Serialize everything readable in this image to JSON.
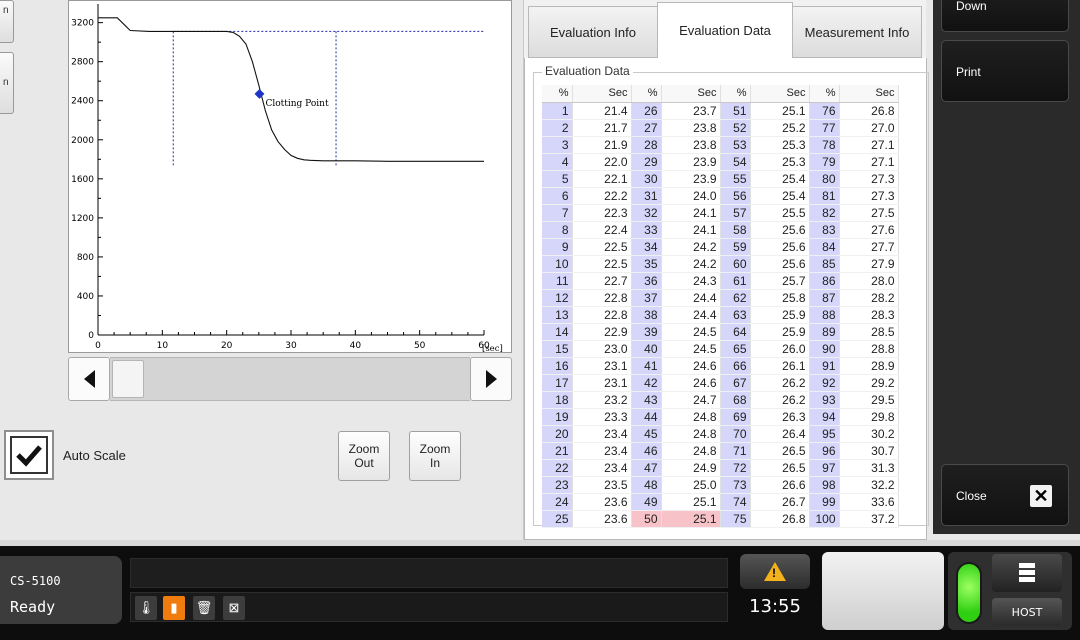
{
  "left_stubs": [
    "n",
    "n"
  ],
  "chart_data": {
    "type": "line",
    "x": [
      0,
      3,
      5,
      8,
      10,
      12,
      15,
      18,
      20,
      21,
      22,
      23,
      24,
      25,
      26,
      27,
      28,
      29,
      30,
      31,
      32,
      33,
      35,
      38,
      40,
      45,
      50,
      55,
      60
    ],
    "y": [
      3250,
      3250,
      3120,
      3110,
      3110,
      3110,
      3110,
      3110,
      3110,
      3100,
      3060,
      2980,
      2800,
      2560,
      2300,
      2100,
      1980,
      1900,
      1840,
      1810,
      1795,
      1790,
      1785,
      1785,
      1785,
      1780,
      1780,
      1780,
      1780
    ],
    "xlim": [
      0,
      60
    ],
    "ylim": [
      0,
      3350
    ],
    "x_ticks": [
      0,
      10,
      20,
      30,
      40,
      50,
      60
    ],
    "y_ticks": [
      0,
      400,
      800,
      1200,
      1600,
      2000,
      2400,
      2800,
      3200
    ],
    "x_unit": "[sec]",
    "clotting_point": {
      "x": 25.1,
      "y": 2470,
      "label": "Clotting Point"
    },
    "reference_line_y": 3110,
    "vertical_markers_x": [
      11.7,
      37.0
    ],
    "marker_bottom_y": 1780
  },
  "controls": {
    "auto_scale_label": "Auto Scale",
    "auto_scale_checked": true,
    "zoom_out_label": "Zoom\nOut",
    "zoom_in_label": "Zoom\nIn"
  },
  "tabs": [
    {
      "label": "Evaluation Info",
      "active": false
    },
    {
      "label": "Evaluation Data",
      "active": true
    },
    {
      "label": "Measurement Info",
      "active": false
    }
  ],
  "evaluation": {
    "group_title": "Evaluation Data",
    "headers": [
      "%",
      "Sec",
      "%",
      "Sec",
      "%",
      "Sec",
      "%",
      "Sec"
    ],
    "rows": [
      [
        "1",
        "21.4",
        "26",
        "23.7",
        "51",
        "25.1",
        "76",
        "26.8"
      ],
      [
        "2",
        "21.7",
        "27",
        "23.8",
        "52",
        "25.2",
        "77",
        "27.0"
      ],
      [
        "3",
        "21.9",
        "28",
        "23.8",
        "53",
        "25.3",
        "78",
        "27.1"
      ],
      [
        "4",
        "22.0",
        "29",
        "23.9",
        "54",
        "25.3",
        "79",
        "27.1"
      ],
      [
        "5",
        "22.1",
        "30",
        "23.9",
        "55",
        "25.4",
        "80",
        "27.3"
      ],
      [
        "6",
        "22.2",
        "31",
        "24.0",
        "56",
        "25.4",
        "81",
        "27.3"
      ],
      [
        "7",
        "22.3",
        "32",
        "24.1",
        "57",
        "25.5",
        "82",
        "27.5"
      ],
      [
        "8",
        "22.4",
        "33",
        "24.1",
        "58",
        "25.6",
        "83",
        "27.6"
      ],
      [
        "9",
        "22.5",
        "34",
        "24.2",
        "59",
        "25.6",
        "84",
        "27.7"
      ],
      [
        "10",
        "22.5",
        "35",
        "24.2",
        "60",
        "25.6",
        "85",
        "27.9"
      ],
      [
        "11",
        "22.7",
        "36",
        "24.3",
        "61",
        "25.7",
        "86",
        "28.0"
      ],
      [
        "12",
        "22.8",
        "37",
        "24.4",
        "62",
        "25.8",
        "87",
        "28.2"
      ],
      [
        "13",
        "22.8",
        "38",
        "24.4",
        "63",
        "25.9",
        "88",
        "28.3"
      ],
      [
        "14",
        "22.9",
        "39",
        "24.5",
        "64",
        "25.9",
        "89",
        "28.5"
      ],
      [
        "15",
        "23.0",
        "40",
        "24.5",
        "65",
        "26.0",
        "90",
        "28.8"
      ],
      [
        "16",
        "23.1",
        "41",
        "24.6",
        "66",
        "26.1",
        "91",
        "28.9"
      ],
      [
        "17",
        "23.1",
        "42",
        "24.6",
        "67",
        "26.2",
        "92",
        "29.2"
      ],
      [
        "18",
        "23.2",
        "43",
        "24.7",
        "68",
        "26.2",
        "93",
        "29.5"
      ],
      [
        "19",
        "23.3",
        "44",
        "24.8",
        "69",
        "26.3",
        "94",
        "29.8"
      ],
      [
        "20",
        "23.4",
        "45",
        "24.8",
        "70",
        "26.4",
        "95",
        "30.2"
      ],
      [
        "21",
        "23.4",
        "46",
        "24.8",
        "71",
        "26.5",
        "96",
        "30.7"
      ],
      [
        "22",
        "23.4",
        "47",
        "24.9",
        "72",
        "26.5",
        "97",
        "31.3"
      ],
      [
        "23",
        "23.5",
        "48",
        "25.0",
        "73",
        "26.6",
        "98",
        "32.2"
      ],
      [
        "24",
        "23.6",
        "49",
        "25.1",
        "74",
        "26.7",
        "99",
        "33.6"
      ],
      [
        "25",
        "23.6",
        "50",
        "25.1",
        "75",
        "26.8",
        "100",
        "37.2"
      ]
    ],
    "highlight_percent": "50",
    "highlight_color": "#f7c3c9",
    "percent_column_color": "#d6d6fb"
  },
  "sidebar": {
    "top_button_label": "Down",
    "print_label": "Print",
    "close_label": "Close"
  },
  "status": {
    "device_model": "CS-5100",
    "device_state": "Ready",
    "time": "13:55",
    "host_label": "HOST",
    "icons": [
      "thermometer-icon",
      "reagent-bottle-icon",
      "waste-bin-icon",
      "cuvette-icon"
    ],
    "active_icon_color": "#f07c10",
    "warning_color": "#f3b21b",
    "connection_color": "#2fcf12"
  }
}
